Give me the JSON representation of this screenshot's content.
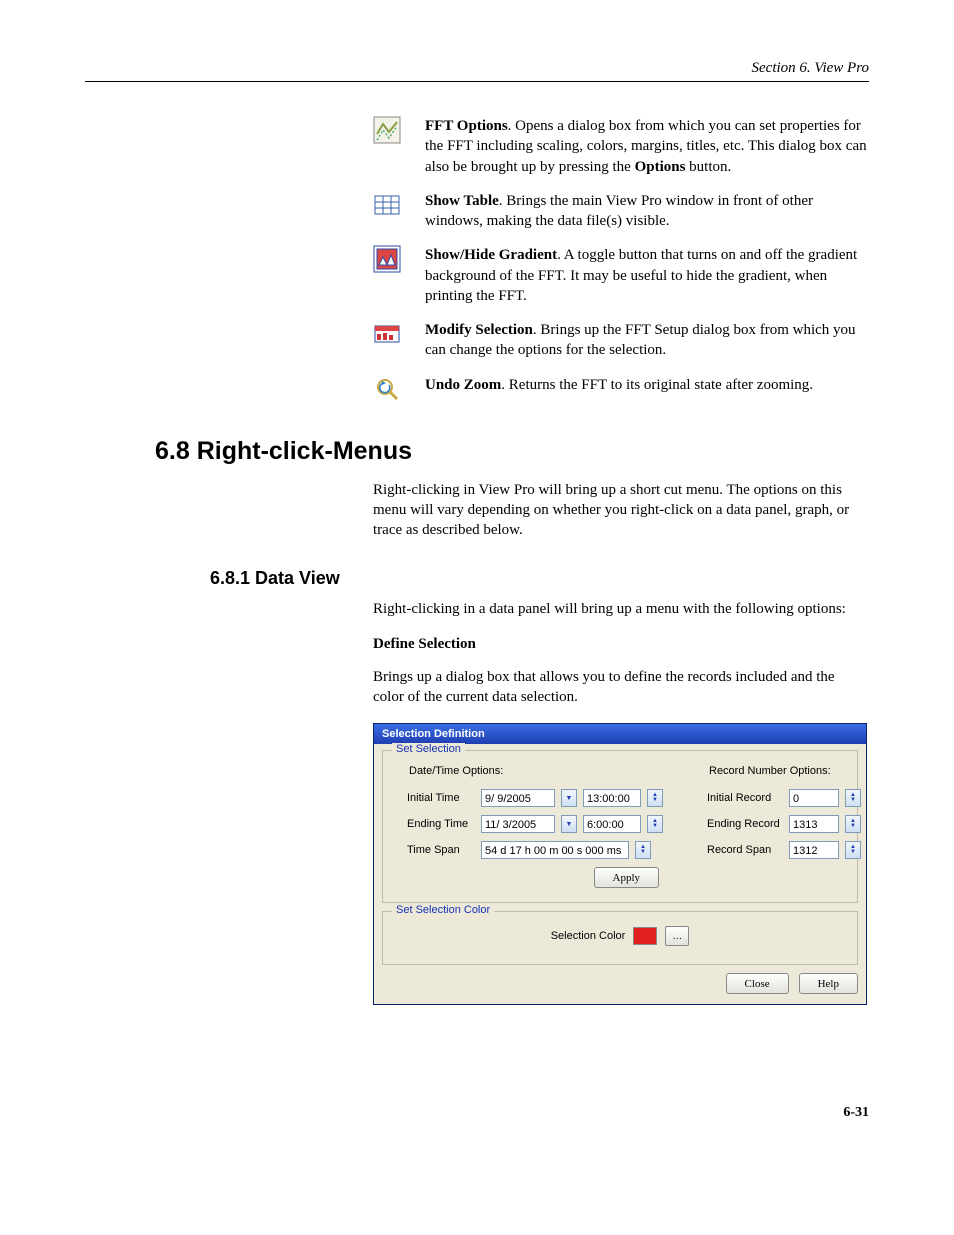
{
  "header": {
    "section_label": "Section 6.  View Pro"
  },
  "icons": {
    "fft_options": {
      "title": "FFT Options",
      "body_span1": ". Opens a dialog box from which you can set properties for the FFT including scaling, colors, margins, titles, etc. This dialog box can also be brought up by pressing the ",
      "bold2": "Options",
      "body_span2": " button."
    },
    "show_table": {
      "title": "Show Table",
      "body": ". Brings the main View Pro window in front of other windows, making the data file(s) visible."
    },
    "gradient": {
      "title": "Show/Hide Gradient",
      "body": ". A toggle button that turns on and off the gradient background of the FFT. It may be useful to hide the gradient, when printing the FFT."
    },
    "modify": {
      "title": "Modify Selection",
      "body": ". Brings up the FFT Setup dialog box from which you can change the options for the selection."
    },
    "undo_zoom": {
      "title": "Undo Zoom",
      "body": ". Returns the FFT to its original state after zooming."
    }
  },
  "section68": {
    "heading": "6.8  Right-click-Menus",
    "para": "Right-clicking in View Pro will bring up a short cut menu.  The options on this menu will vary depending on whether you right-click on a data panel, graph, or trace as described below."
  },
  "section681": {
    "heading": "6.8.1  Data View",
    "para1": "Right-clicking in a data panel will bring up a menu with the following options:",
    "sub_bold": "Define Selection",
    "para2": "Brings up a dialog box that allows you to define the records included and the color of the current data selection."
  },
  "dialog": {
    "title": "Selection Definition",
    "set_sel": {
      "legend": "Set Selection",
      "dt_title": "Date/Time Options:",
      "rn_title": "Record Number Options:",
      "initial_time_label": "Initial Time",
      "initial_date_val": "9/ 9/2005",
      "initial_time_val": "13:00:00",
      "ending_time_label": "Ending Time",
      "ending_date_val": "11/ 3/2005",
      "ending_time_val": "6:00:00",
      "timespan_label": "Time Span",
      "timespan_val": "54 d 17 h 00 m 00 s 000 ms",
      "initial_record_label": "Initial Record",
      "initial_record_val": "0",
      "ending_record_label": "Ending Record",
      "ending_record_val": "1313",
      "record_span_label": "Record Span",
      "record_span_val": "1312",
      "apply": "Apply"
    },
    "color": {
      "legend": "Set Selection Color",
      "label": "Selection Color"
    },
    "close": "Close",
    "help": "Help"
  },
  "pagenum": "6-31"
}
